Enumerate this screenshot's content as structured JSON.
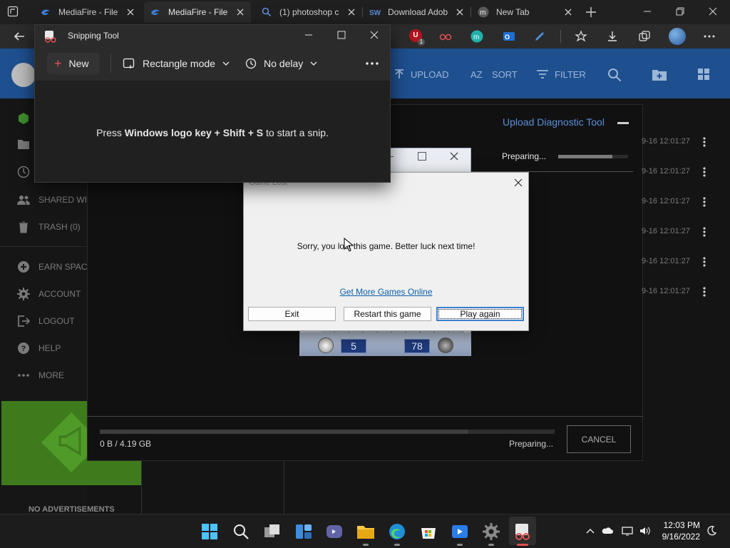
{
  "browser": {
    "tabs": [
      {
        "label": "MediaFire - File",
        "icon": "mediafire-icon",
        "active": false
      },
      {
        "label": "MediaFire - File",
        "icon": "mediafire-icon",
        "active": true
      },
      {
        "label": "(1) photoshop c",
        "icon": "search-icon",
        "active": false
      },
      {
        "label": "Download Adob",
        "icon": "sw-icon",
        "active": false
      },
      {
        "label": "New Tab",
        "icon": "m-icon",
        "active": false
      }
    ],
    "extension_badge": "1"
  },
  "snipping_tool": {
    "title": "Snipping Tool",
    "new_label": "New",
    "mode_label": "Rectangle mode",
    "delay_label": "No delay",
    "message_prefix": "Press ",
    "message_keys": "Windows logo key + Shift + S",
    "message_suffix": " to start a snip."
  },
  "mediafire": {
    "toolbar": {
      "upload": "UPLOAD",
      "sort": "SORT",
      "filter": "FILTER"
    },
    "sidebar": {
      "shared": "SHARED WIT",
      "trash": "TRASH (0)",
      "earn": "EARN SPACE",
      "account": "ACCOUNT",
      "logout": "LOGOUT",
      "help": "HELP",
      "more": "MORE"
    },
    "ad_label": "NO ADVERTISEMENTS",
    "upload_panel": {
      "title": "Upload Diagnostic Tool",
      "preparing": "Preparing...",
      "progress_fraction": 0.78,
      "rows": [
        "9-16 12:01:27",
        "9-16 12:01:27",
        "9-16 12:01:27",
        "9-16 12:01:27",
        "9-16 12:01:27",
        "9-16 12:01:27"
      ],
      "size_text": "0 B / 4.19 GB",
      "bottom_status": "Preparing...",
      "bottom_progress_fraction": 0.81,
      "cancel": "CANCEL"
    }
  },
  "game_window": {
    "counter_left": "5",
    "counter_right": "78"
  },
  "game_lost_dialog": {
    "title": "Game Lost",
    "message": "Sorry, you lost this game. Better luck next time!",
    "link": "Get More Games Online",
    "buttons": {
      "exit": "Exit",
      "restart": "Restart this game",
      "play_again": "Play again"
    }
  },
  "taskbar": {
    "time": "12:03 PM",
    "date": "9/16/2022"
  },
  "colors": {
    "mediafire_blue": "#1e4f8f",
    "link_blue": "#0a5fa8",
    "snip_accent": "#e25353"
  }
}
